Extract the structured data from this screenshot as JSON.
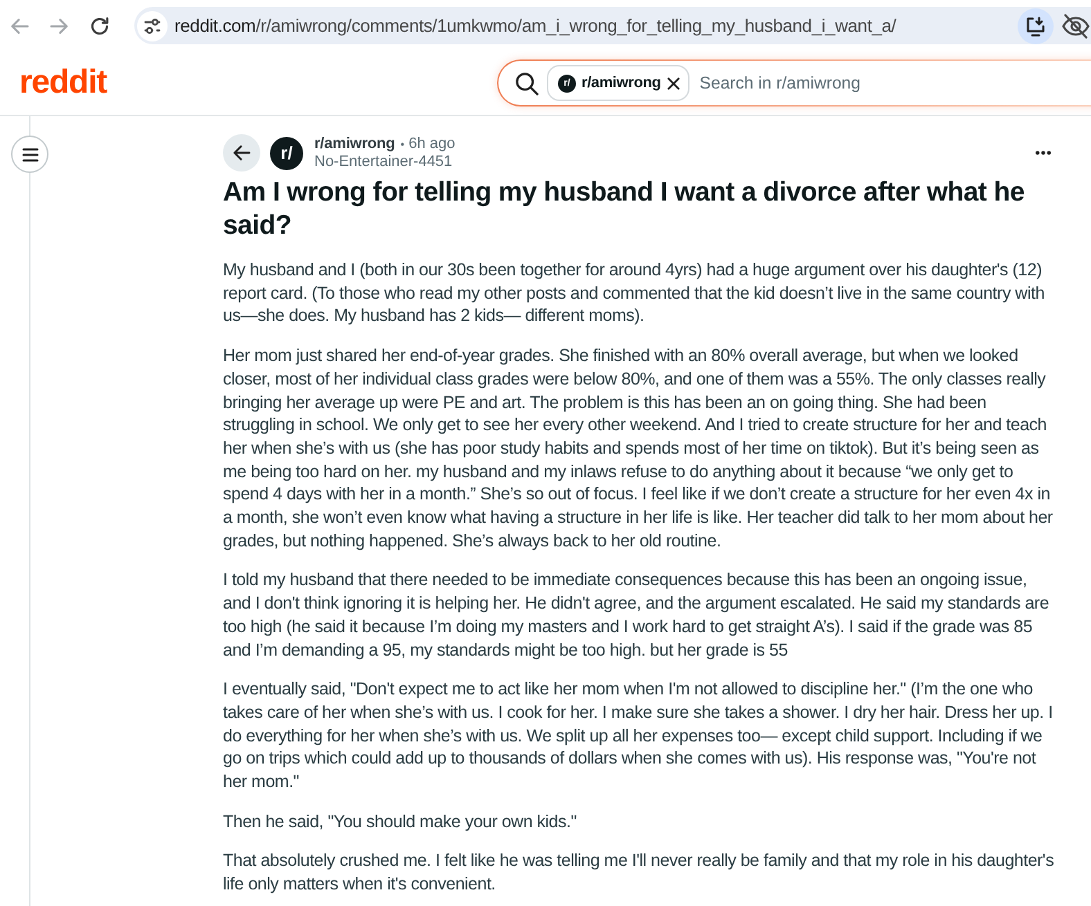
{
  "browser": {
    "nav_buttons": [
      {
        "kind": "back",
        "disabled": true
      },
      {
        "kind": "forward",
        "disabled": true
      },
      {
        "kind": "reload",
        "disabled": false
      }
    ],
    "url": {
      "host": "reddit.com",
      "path": "/r/amiwrong/comments/1umkwmo/am_i_wrong_for_telling_my_husband_i_want_a/"
    }
  },
  "header": {
    "logo": "reddit",
    "search": {
      "chip": {
        "avatar": "r/",
        "label": "r/amiwrong"
      },
      "placeholder": "Search in r/amiwrong"
    }
  },
  "post": {
    "avatar": "r/",
    "subreddit": "r/amiwrong",
    "separator": "•",
    "time": "6h ago",
    "author": "No-Entertainer-4451",
    "title": "Am I wrong for telling my husband I want a divorce after what he said?",
    "paragraphs": [
      "My husband and I (both in our 30s been together for around 4yrs) had a huge argument over his daughter's (12) report card. (To those who read my other posts and commented that the kid doesn’t live in the same country with us—she does. My husband has 2 kids— different moms).",
      "Her mom just shared her end-of-year grades. She finished with an 80% overall average, but when we looked closer, most of her individual class grades were below 80%, and one of them was a 55%. The only classes really bringing her average up were PE and art. The problem is this has been an on going thing. She had been struggling in school. We only get to see her every other weekend. And I tried to create structure for her and teach her when she’s with us (she has poor study habits and spends most of her time on tiktok). But it’s being seen as me being too hard on her. my husband and my inlaws refuse to do anything about it because “we only get to spend 4 days with her in a month.” She’s so out of focus. I feel like if we don’t create a structure for her even 4x in a month, she won’t even know what having a structure in her life is like. Her teacher did talk to her mom about her grades, but nothing happened. She’s always back to her old routine.",
      "I told my husband that there needed to be immediate consequences because this has been an ongoing issue, and I don't think ignoring it is helping her. He didn't agree, and the argument escalated. He said my standards are too high (he said it because I’m doing my masters and I work hard to get straight A’s). I said if the grade was 85 and I’m demanding a 95, my standards might be too high. but her grade is 55",
      "I eventually said, \"Don't expect me to act like her mom when I'm not allowed to discipline her.\" (I’m the one who takes care of her when she’s with us. I cook for her. I make sure she takes a shower. I dry her hair. Dress her up. I do everything for her when she’s with us. We split up all her expenses too— except child support. Including if we go on trips which could add up to thousands of dollars when she comes with us). His response was, \"You're not her mom.\"",
      "Then he said, \"You should make your own kids.\"",
      "That absolutely crushed me. I felt like he was telling me I'll never really be family and that my role in his daughter's life only matters when it's convenient."
    ]
  }
}
